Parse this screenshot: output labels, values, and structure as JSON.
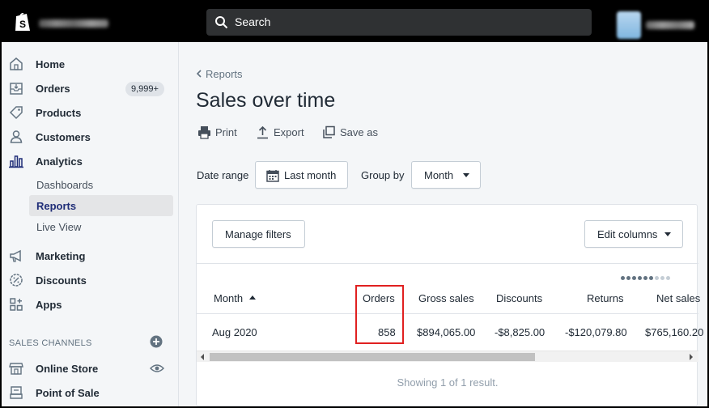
{
  "header": {
    "search_placeholder": "Search"
  },
  "sidebar": {
    "items": [
      {
        "label": "Home",
        "icon": "home-icon"
      },
      {
        "label": "Orders",
        "icon": "orders-icon",
        "badge": "9,999+"
      },
      {
        "label": "Products",
        "icon": "tag-icon"
      },
      {
        "label": "Customers",
        "icon": "person-icon"
      },
      {
        "label": "Analytics",
        "icon": "bar-chart-icon"
      }
    ],
    "analytics_sub": [
      {
        "label": "Dashboards"
      },
      {
        "label": "Reports",
        "active": true
      },
      {
        "label": "Live View"
      }
    ],
    "items2": [
      {
        "label": "Marketing",
        "icon": "megaphone-icon"
      },
      {
        "label": "Discounts",
        "icon": "discount-icon"
      },
      {
        "label": "Apps",
        "icon": "apps-icon"
      }
    ],
    "channels_title": "SALES CHANNELS",
    "channels": [
      {
        "label": "Online Store",
        "icon": "store-icon"
      },
      {
        "label": "Point of Sale",
        "icon": "pos-icon"
      }
    ]
  },
  "page": {
    "breadcrumb": "Reports",
    "title": "Sales over time",
    "actions": {
      "print": "Print",
      "export": "Export",
      "save_as": "Save as"
    },
    "date_range_label": "Date range",
    "date_range_value": "Last month",
    "group_by_label": "Group by",
    "group_by_value": "Month"
  },
  "table": {
    "manage_filters": "Manage filters",
    "edit_columns": "Edit columns",
    "columns": [
      "Month",
      "Orders",
      "Gross sales",
      "Discounts",
      "Returns",
      "Net sales"
    ],
    "rows": [
      [
        "Aug 2020",
        "858",
        "$894,065.00",
        "-$8,825.00",
        "-$120,079.80",
        "$765,160.20"
      ]
    ],
    "footer": "Showing 1 of 1 result."
  },
  "colors": {
    "topbar": "#000000",
    "sidebar_bg": "#f4f6f8",
    "active_nav": "#202e78",
    "highlight_box": "#e02020"
  }
}
